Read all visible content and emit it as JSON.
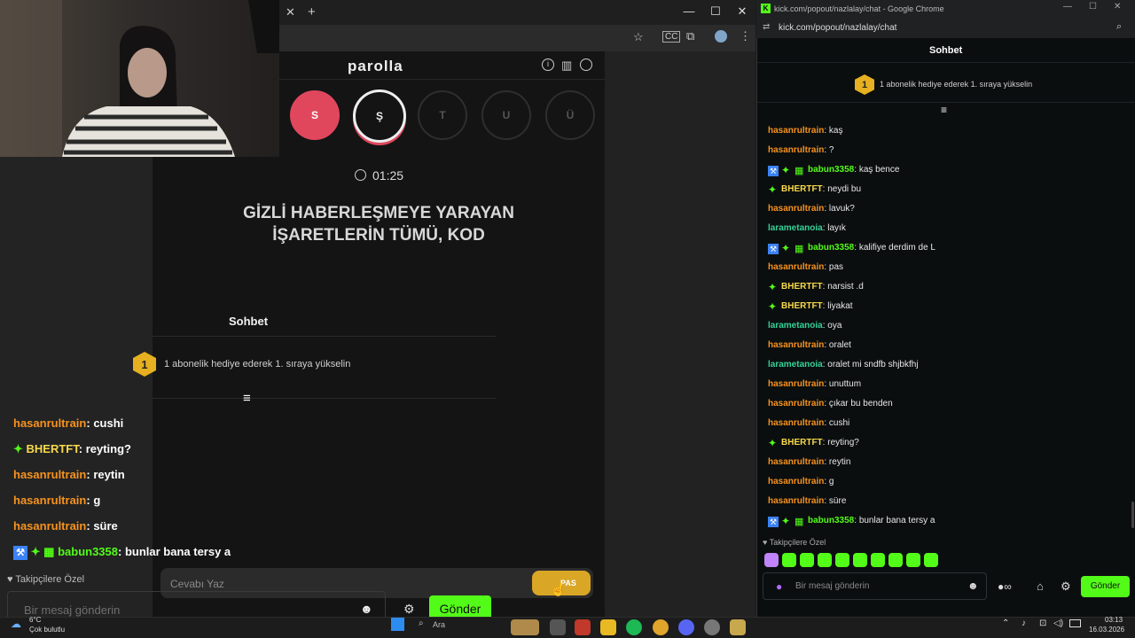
{
  "left_window": {
    "address": "",
    "controls": {
      "minimize": "—",
      "maximize": "☐",
      "close": "✕"
    }
  },
  "game": {
    "title": "parolla",
    "letters": [
      "S",
      "Ş",
      "T",
      "U",
      "Ü"
    ],
    "timer": "01:25",
    "question_line1": "GİZLİ HABERLEŞMEYE YARAYAN",
    "question_line2": "İŞARETLERİN TÜMÜ, KOD",
    "answer_placeholder": "Cevabı Yaz",
    "pass_label": "PAS"
  },
  "overlay_chat": {
    "header": "Sohbet",
    "promo": "1 abonelik hediye ederek 1. sıraya yükselin",
    "promo_rank": "1",
    "messages": [
      {
        "user": "hasanrultrain",
        "text": "cushi"
      },
      {
        "user": "BHERTFT",
        "text": "reyting?"
      },
      {
        "user": "hasanrultrain",
        "text": "reytin"
      },
      {
        "user": "hasanrultrain",
        "text": "g"
      },
      {
        "user": "hasanrultrain",
        "text": "süre"
      },
      {
        "user": "babun3358",
        "text": "bunlar bana tersy a"
      }
    ],
    "followers_only": "Takipçilere Özel",
    "input_placeholder": "Bir mesaj gönderin",
    "send_label": "Gönder",
    "weather_temp": "6°C",
    "weather_desc": "Çok bulutlu"
  },
  "right_window": {
    "title": "kick.com/popout/nazlalay/chat - Google Chrome",
    "url": "kick.com/popout/nazlalay/chat",
    "chat_header": "Sohbet",
    "promo": "1 abonelik hediye ederek 1. sıraya yükselin",
    "promo_rank": "1",
    "messages": [
      {
        "user": "hasanrultrain",
        "color": "orange",
        "badges": "",
        "text": "kaş"
      },
      {
        "user": "hasanrultrain",
        "color": "orange",
        "badges": "",
        "text": "?"
      },
      {
        "user": "babun3358",
        "color": "lime",
        "badges": "triple",
        "text": "kaş bence"
      },
      {
        "user": "BHERTFT",
        "color": "yellow",
        "badges": "single",
        "text": "neydi bu"
      },
      {
        "user": "hasanrultrain",
        "color": "orange",
        "badges": "",
        "text": "lavuk?"
      },
      {
        "user": "larametanoia",
        "color": "teal",
        "badges": "",
        "text": "layık"
      },
      {
        "user": "babun3358",
        "color": "lime",
        "badges": "triple",
        "text": "kalifiye derdim de L"
      },
      {
        "user": "hasanrultrain",
        "color": "orange",
        "badges": "",
        "text": "pas"
      },
      {
        "user": "BHERTFT",
        "color": "yellow",
        "badges": "single",
        "text": "narsist .d"
      },
      {
        "user": "BHERTFT",
        "color": "yellow",
        "badges": "single",
        "text": "liyakat"
      },
      {
        "user": "larametanoia",
        "color": "teal",
        "badges": "",
        "text": "oya"
      },
      {
        "user": "hasanrultrain",
        "color": "orange",
        "badges": "",
        "text": "oralet"
      },
      {
        "user": "larametanoia",
        "color": "teal",
        "badges": "",
        "text": "oralet mi sndfb shjbkfhj"
      },
      {
        "user": "hasanrultrain",
        "color": "orange",
        "badges": "",
        "text": "unuttum"
      },
      {
        "user": "hasanrultrain",
        "color": "orange",
        "badges": "",
        "text": "çıkar bu benden"
      },
      {
        "user": "hasanrultrain",
        "color": "orange",
        "badges": "",
        "text": "cushi"
      },
      {
        "user": "BHERTFT",
        "color": "yellow",
        "badges": "single",
        "text": "reyting?"
      },
      {
        "user": "hasanrultrain",
        "color": "orange",
        "badges": "",
        "text": "reytin"
      },
      {
        "user": "hasanrultrain",
        "color": "orange",
        "badges": "",
        "text": "g"
      },
      {
        "user": "hasanrultrain",
        "color": "orange",
        "badges": "",
        "text": "süre"
      },
      {
        "user": "babun3358",
        "color": "lime",
        "badges": "triple",
        "text": "bunlar bana tersy a"
      }
    ],
    "followers_only": "Takipçilere Özel",
    "input_placeholder": "Bir mesaj gönderin",
    "send_label": "Gönder"
  },
  "taskbar": {
    "search_label": "Ara",
    "time": "03:13",
    "date": "16.03.2026"
  },
  "colors": {
    "kick_green": "#53fc18",
    "game_red": "#e0475d",
    "pass_yellow": "#d9a625"
  }
}
